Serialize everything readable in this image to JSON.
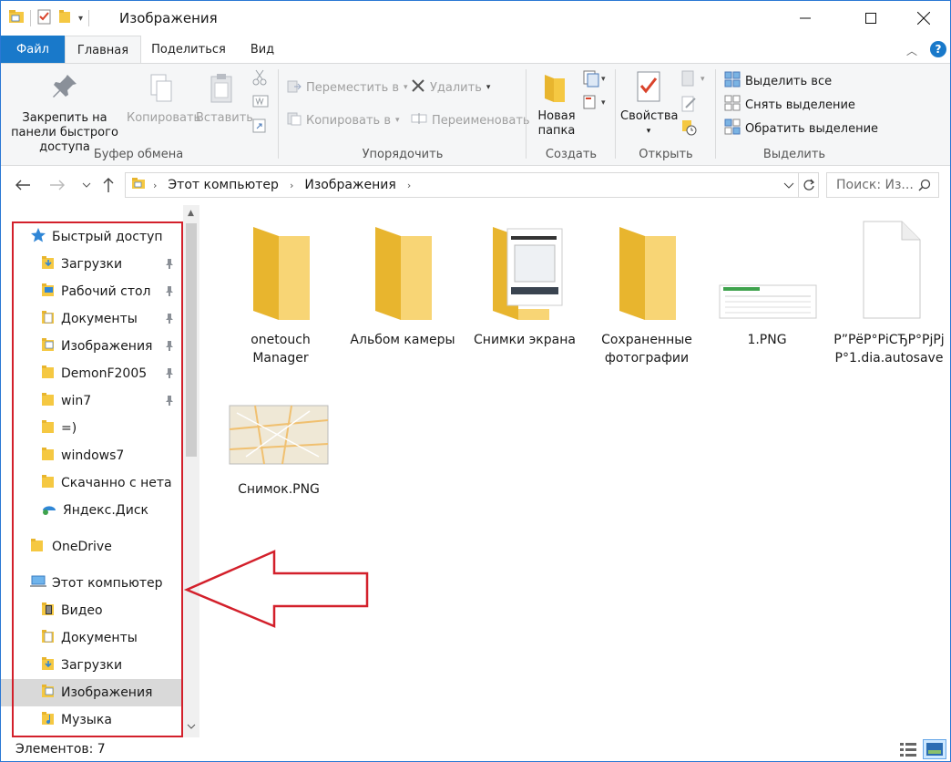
{
  "window": {
    "title": "Изображения"
  },
  "tabs": {
    "file": "Файл",
    "home": "Главная",
    "share": "Поделиться",
    "view": "Вид"
  },
  "ribbon": {
    "clipboard": {
      "label": "Буфер обмена",
      "pin": "Закрепить на панели быстрого доступа",
      "copy": "Копировать",
      "paste": "Вставить"
    },
    "organize": {
      "label": "Упорядочить",
      "move": "Переместить в",
      "copy_to": "Копировать в",
      "delete": "Удалить",
      "rename": "Переименовать"
    },
    "create": {
      "label": "Создать",
      "new_folder": "Новая папка"
    },
    "open": {
      "label": "Открыть",
      "properties": "Свойства"
    },
    "select": {
      "label": "Выделить",
      "select_all": "Выделить все",
      "select_none": "Снять выделение",
      "invert": "Обратить выделение"
    }
  },
  "address": {
    "seg1": "Этот компьютер",
    "seg2": "Изображения",
    "search_placeholder": "Поиск: Из..."
  },
  "nav": {
    "quick_access": "Быстрый доступ",
    "qa_items": [
      "Загрузки",
      "Рабочий стол",
      "Документы",
      "Изображения",
      "DemonF2005",
      "win7",
      "=)",
      "windows7",
      "Скачанно с нета",
      "Яндекс.Диск"
    ],
    "onedrive": "OneDrive",
    "this_pc": "Этот компьютер",
    "pc_items": [
      "Видео",
      "Документы",
      "Загрузки",
      "Изображения",
      "Музыка"
    ]
  },
  "files": [
    {
      "name": "onetouch Manager"
    },
    {
      "name": "Альбом камеры"
    },
    {
      "name": "Снимки экрана"
    },
    {
      "name": "Сохраненные фотографии"
    },
    {
      "name": "1.PNG"
    },
    {
      "name": "Р”РёР°РіСЂР°РјРјР°1.dia.autosave"
    },
    {
      "name": "Снимок.PNG"
    }
  ],
  "status": {
    "count": "Элементов: 7"
  },
  "colors": {
    "accent": "#1979ca",
    "folder": "#f5c842",
    "annotation": "#d3202b"
  }
}
